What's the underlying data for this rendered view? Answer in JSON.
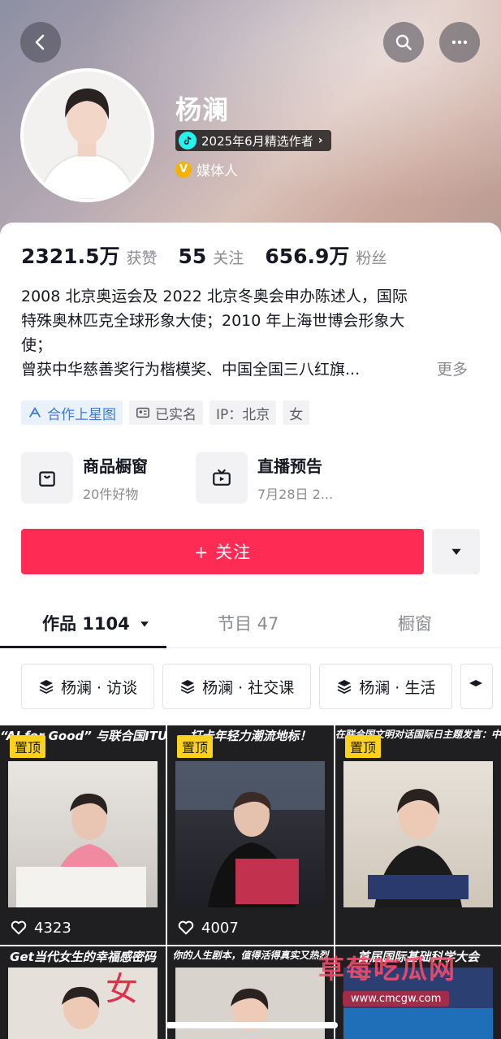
{
  "header": {
    "name": "杨澜",
    "creator_badge": "2025年6月精选作者",
    "identity_badge": "V",
    "identity": "媒体人"
  },
  "stats": [
    {
      "value": "2321.5万",
      "label": "获赞"
    },
    {
      "value": "55",
      "label": "关注"
    },
    {
      "value": "656.9万",
      "label": "粉丝"
    }
  ],
  "bio": {
    "lines": [
      "2008 北京奥运会及 2022 北京冬奥会申办陈述人，国际",
      "特殊奥林匹克全球形象大使；2010 年上海世博会形象大",
      "使；",
      "曾获中华慈善奖行为楷模奖、中国全国三八红旗..."
    ],
    "more": "更多"
  },
  "tags": [
    "合作上星图",
    "已实名",
    "IP：北京",
    "女"
  ],
  "services": [
    {
      "title": "商品橱窗",
      "subtitle": "20件好物",
      "icon": "bag-icon"
    },
    {
      "title": "直播预告",
      "subtitle": "7月28日 2...",
      "icon": "tv-icon"
    }
  ],
  "follow_button": "+ 关注",
  "tabs": [
    {
      "label": "作品 1104"
    },
    {
      "label": "节目 47"
    },
    {
      "label": "橱窗"
    }
  ],
  "collections": [
    "杨澜 · 访谈",
    "杨澜 · 社交课",
    "杨澜 · 生活"
  ],
  "videos": [
    {
      "caption": "“AI for Good” 与联合国ITU峰会致辞",
      "pinned": "置顶",
      "likes": "4323"
    },
    {
      "caption": "打卡年轻力潮流地标！",
      "pinned": "置顶",
      "likes": "4007"
    },
    {
      "caption": "在联合国文明对话国际日主题发言：中华造物智慧",
      "pinned": "置顶",
      "likes": ""
    },
    {
      "caption": "Get当代女生的幸福感密码",
      "pinned": "",
      "likes": ""
    },
    {
      "caption": "你的人生剧本，值得活得真实又热烈",
      "pinned": "",
      "likes": ""
    },
    {
      "caption": "首届国际基础科学大会",
      "pinned": "",
      "likes": ""
    }
  ],
  "watermark": {
    "title": "草莓吃瓜网",
    "url": "www.cmcgw.com"
  },
  "colors": {
    "accent": "#fe2c55",
    "pin": "#fbd31c",
    "verified": "#f5b300"
  }
}
